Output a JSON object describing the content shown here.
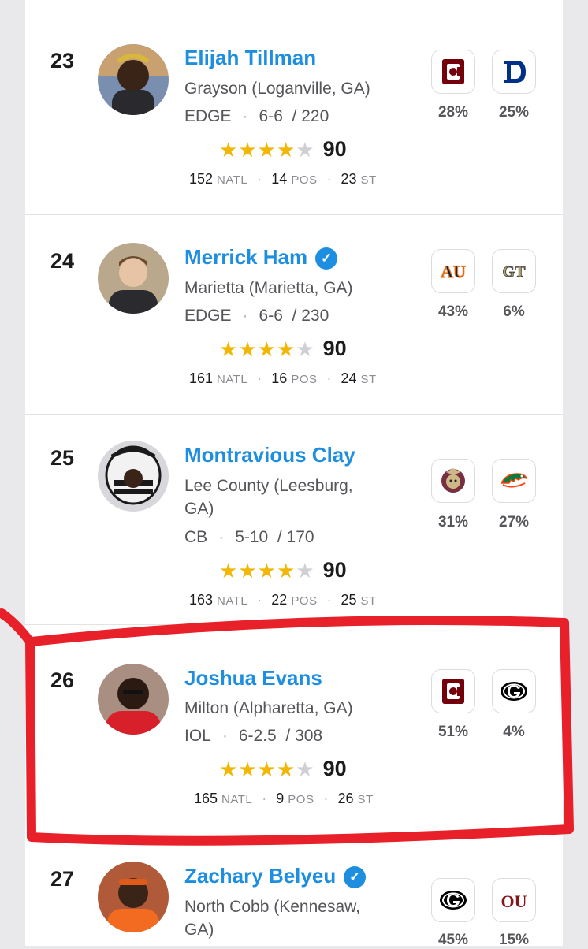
{
  "prospects": [
    {
      "rank": "23",
      "name": "Elijah Tillman",
      "verified": false,
      "school": "Grayson (Loganville, GA)",
      "position": "EDGE",
      "height": "6-6",
      "weight": "/ 220",
      "rating": "90",
      "stars": 4,
      "natl": "152",
      "natl_label": "NATL",
      "pos": "14",
      "pos_label": "POS",
      "st": "23",
      "st_label": "ST",
      "teams": [
        {
          "icon": "south-carolina-logo-icon",
          "pct": "28%"
        },
        {
          "icon": "duke-logo-icon",
          "pct": "25%"
        }
      ]
    },
    {
      "rank": "24",
      "name": "Merrick Ham",
      "verified": true,
      "school": "Marietta (Marietta, GA)",
      "position": "EDGE",
      "height": "6-6",
      "weight": "/ 230",
      "rating": "90",
      "stars": 4,
      "natl": "161",
      "natl_label": "NATL",
      "pos": "16",
      "pos_label": "POS",
      "st": "24",
      "st_label": "ST",
      "teams": [
        {
          "icon": "auburn-logo-icon",
          "pct": "43%"
        },
        {
          "icon": "georgia-tech-logo-icon",
          "pct": "6%"
        }
      ]
    },
    {
      "rank": "25",
      "name": "Montravious Clay",
      "verified": false,
      "school": "Lee County (Leesburg, GA)",
      "position": "CB",
      "height": "5-10",
      "weight": "/ 170",
      "rating": "90",
      "stars": 4,
      "natl": "163",
      "natl_label": "NATL",
      "pos": "22",
      "pos_label": "POS",
      "st": "25",
      "st_label": "ST",
      "teams": [
        {
          "icon": "florida-state-logo-icon",
          "pct": "31%"
        },
        {
          "icon": "florida-logo-icon",
          "pct": "27%"
        }
      ]
    },
    {
      "rank": "26",
      "name": "Joshua Evans",
      "verified": false,
      "school": "Milton (Alpharetta, GA)",
      "position": "IOL",
      "height": "6-2.5",
      "weight": "/ 308",
      "rating": "90",
      "stars": 4,
      "natl": "165",
      "natl_label": "NATL",
      "pos": "9",
      "pos_label": "POS",
      "st": "26",
      "st_label": "ST",
      "teams": [
        {
          "icon": "south-carolina-logo-icon",
          "pct": "51%"
        },
        {
          "icon": "georgia-logo-icon",
          "pct": "4%"
        }
      ]
    },
    {
      "rank": "27",
      "name": "Zachary Belyeu",
      "verified": true,
      "school": "North Cobb (Kennesaw, GA)",
      "position": "",
      "height": "",
      "weight": "",
      "rating": "",
      "stars": 0,
      "teams": [
        {
          "icon": "georgia-logo-icon",
          "pct": "45%"
        },
        {
          "icon": "oklahoma-logo-icon",
          "pct": "15%"
        }
      ]
    }
  ],
  "colors": {
    "name_link": "#1e8fe0",
    "star_on": "#f2b705",
    "star_off": "#cfcfd4",
    "highlight_annotation": "#e8202a"
  }
}
